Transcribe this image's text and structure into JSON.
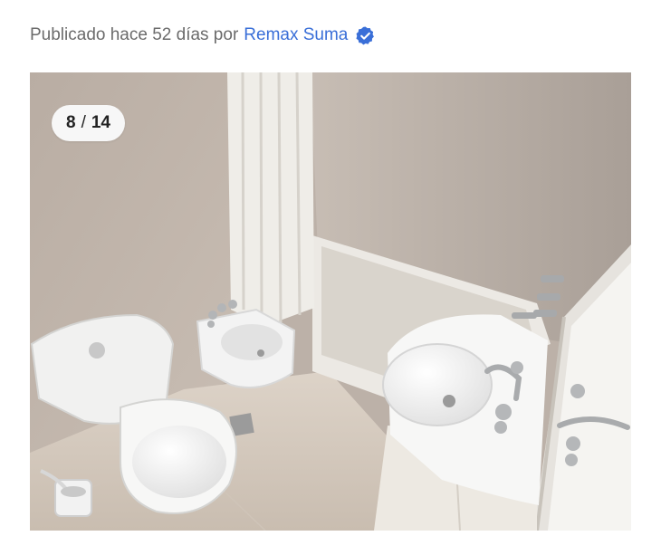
{
  "header": {
    "published_text": "Publicado hace 52 días por",
    "agency_name": "Remax Suma",
    "verified_icon": "verified-badge-icon",
    "link_color": "#3a6fd8"
  },
  "gallery": {
    "current": "8",
    "separator": "/",
    "total": "14",
    "image_alt": "Baño con inodoro, bidet, bañera con cortina y lavatorio"
  }
}
